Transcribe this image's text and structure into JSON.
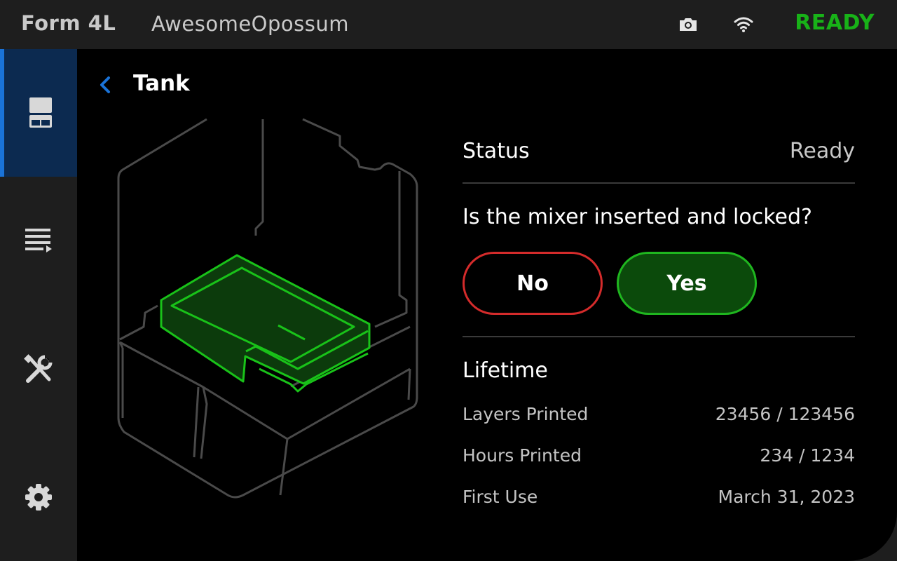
{
  "topbar": {
    "model": "Form 4L",
    "printer_name": "AwesomeOpossum",
    "status": "READY",
    "status_color": "#18b218"
  },
  "sidebar": {
    "items": [
      {
        "icon": "printer-icon",
        "active": true
      },
      {
        "icon": "queue-icon",
        "active": false
      },
      {
        "icon": "tools-icon",
        "active": false
      },
      {
        "icon": "gear-icon",
        "active": false
      }
    ]
  },
  "page": {
    "title": "Tank"
  },
  "status": {
    "label": "Status",
    "value": "Ready"
  },
  "prompt": {
    "question": "Is the mixer inserted and locked?",
    "no_label": "No",
    "yes_label": "Yes"
  },
  "lifetime": {
    "title": "Lifetime",
    "stats": [
      {
        "label": "Layers Printed",
        "value": "23456 / 123456"
      },
      {
        "label": "Hours Printed",
        "value": "234 / 1234"
      },
      {
        "label": "First Use",
        "value": "March 31, 2023"
      }
    ]
  },
  "colors": {
    "accent": "#1a73d8",
    "highlight_green": "#1fb61f",
    "danger_red": "#d42b2b"
  }
}
